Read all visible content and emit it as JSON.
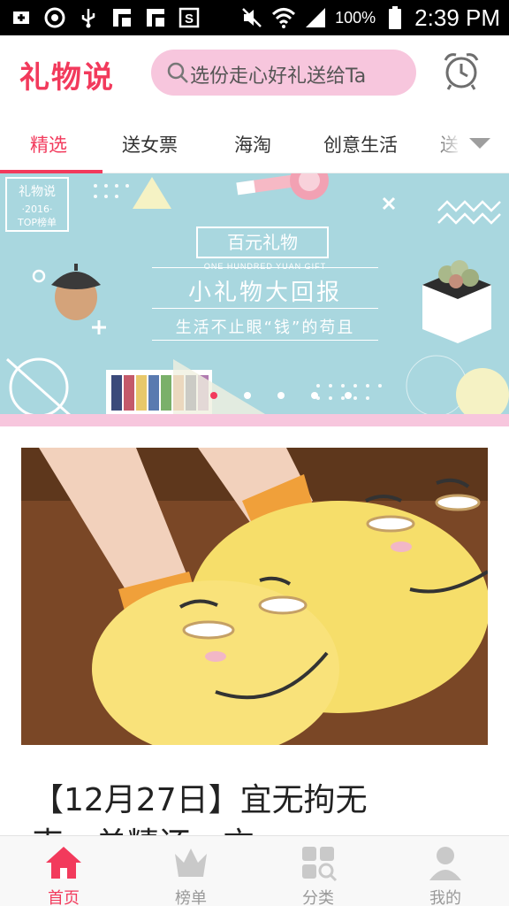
{
  "status_bar": {
    "battery": "100%",
    "time": "2:39 PM",
    "icons": [
      "add-box-icon",
      "sync-icon",
      "usb-icon",
      "notification-icon",
      "notification-icon",
      "s-app-icon",
      "mute-icon",
      "wifi-icon",
      "signal-icon",
      "battery-icon"
    ]
  },
  "header": {
    "logo": "礼物说",
    "search_text": "选份走心好礼送给Ta",
    "alarm_icon": "alarm-clock-icon"
  },
  "tabs": [
    {
      "label": "精选",
      "active": true
    },
    {
      "label": "送女票",
      "active": false
    },
    {
      "label": "海淘",
      "active": false
    },
    {
      "label": "创意生活",
      "active": false
    },
    {
      "label": "送",
      "active": false
    }
  ],
  "banner": {
    "badge_brand": "礼物说",
    "badge_year": "·2016·",
    "badge_text": "TOP榜单",
    "title": "百元礼物",
    "subtitle_en": "ONE HUNDRED YUAN GIFT",
    "headline": "小礼物大回报",
    "tagline": "生活不止眼“钱”的苟且",
    "page_count": 5,
    "current_page": 1
  },
  "article": {
    "title": "【12月27日】宜无拘无",
    "title_line2": "束，单精还一方"
  },
  "bottom_nav": [
    {
      "label": "首页",
      "icon": "home-icon",
      "active": true
    },
    {
      "label": "榜单",
      "icon": "crown-icon",
      "active": false
    },
    {
      "label": "分类",
      "icon": "category-icon",
      "active": false
    },
    {
      "label": "我的",
      "icon": "profile-icon",
      "active": false
    }
  ],
  "colors": {
    "accent": "#f23a5c",
    "search_bg": "#f7c6dd",
    "banner_bg": "#a9d7df"
  }
}
